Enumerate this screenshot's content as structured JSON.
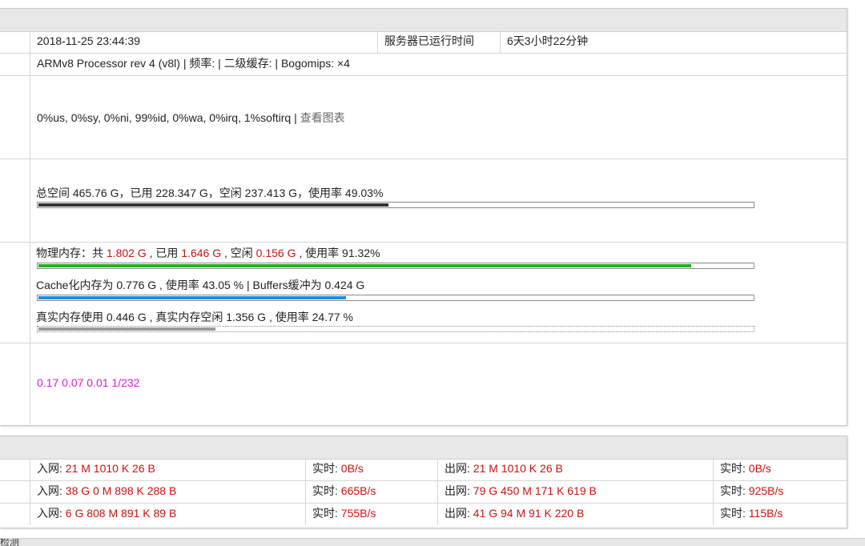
{
  "server": {
    "time": "2018-11-25 23:44:39",
    "uptime_label": "服务器已运行时间",
    "uptime_value": "6天3小时22分钟",
    "cpu_info": "ARMv8 Processor rev 4 (v8l) | 频率: | 二级缓存: | Bogomips: ×4",
    "cpu_usage": "0%us, 0%sy, 0%ni, 99%id, 0%wa, 0%irq, 1%softirq",
    "cpu_sep": " | ",
    "cpu_chart_link": "查看图表"
  },
  "disk": {
    "text": "总空间 465.76 G，已用 228.347 G，空闲 237.413 G，使用率 49.03%",
    "usage_fraction": 0.4903
  },
  "memory": {
    "physical": {
      "prefix": "物理内存：共 ",
      "total": "1.802 G",
      "used_label": " , 已用 ",
      "used": "1.646 G",
      "free_label": " , 空闲 ",
      "free": "0.156 G",
      "rate_label": " , 使用率 91.32%",
      "usage_fraction": 0.9132
    },
    "cache": {
      "text": "Cache化内存为 0.776 G , 使用率 43.05 % | Buffers缓冲为 0.424 G",
      "usage_fraction": 0.4305
    },
    "real": {
      "text": "真实内存使用 0.446 G , 真实内存空闲 1.356 G , 使用率 24.77 %",
      "usage_fraction": 0.2477
    }
  },
  "load": {
    "text": "0.17 0.07 0.01 1/232"
  },
  "network": {
    "rows": [
      {
        "in_label": "入网: ",
        "in": "21 M 1010 K 26 B",
        "in_rt_label": "实时: ",
        "in_rt": "0B/s",
        "out_label": "出网: ",
        "out": "21 M 1010 K 26 B",
        "out_rt_label": "实时: ",
        "out_rt": "0B/s"
      },
      {
        "in_label": "入网: ",
        "in": "38 G 0 M 898 K 288 B",
        "in_rt_label": "实时: ",
        "in_rt": "665B/s",
        "out_label": "出网: ",
        "out": "79 G 450 M 171 K 619 B",
        "out_rt_label": "实时: ",
        "out_rt": "925B/s"
      },
      {
        "in_label": "入网: ",
        "in": "6 G 808 M 891 K 89 B",
        "in_rt_label": "实时: ",
        "in_rt": "755B/s",
        "out_label": "出网: ",
        "out": "41 G 94 M 91 K 220 B",
        "out_rt_label": "实时: ",
        "out_rt": "115B/s"
      }
    ]
  },
  "footer": {
    "partial_text": "检测"
  },
  "colors": {
    "physical_bar": "#22b022",
    "cache_bar": "#1a8fe0",
    "disk_bar": "#333333",
    "real_bar": "#9a9a9a",
    "accent_red": "#cc1111",
    "load_magenta": "#d81bd8"
  }
}
